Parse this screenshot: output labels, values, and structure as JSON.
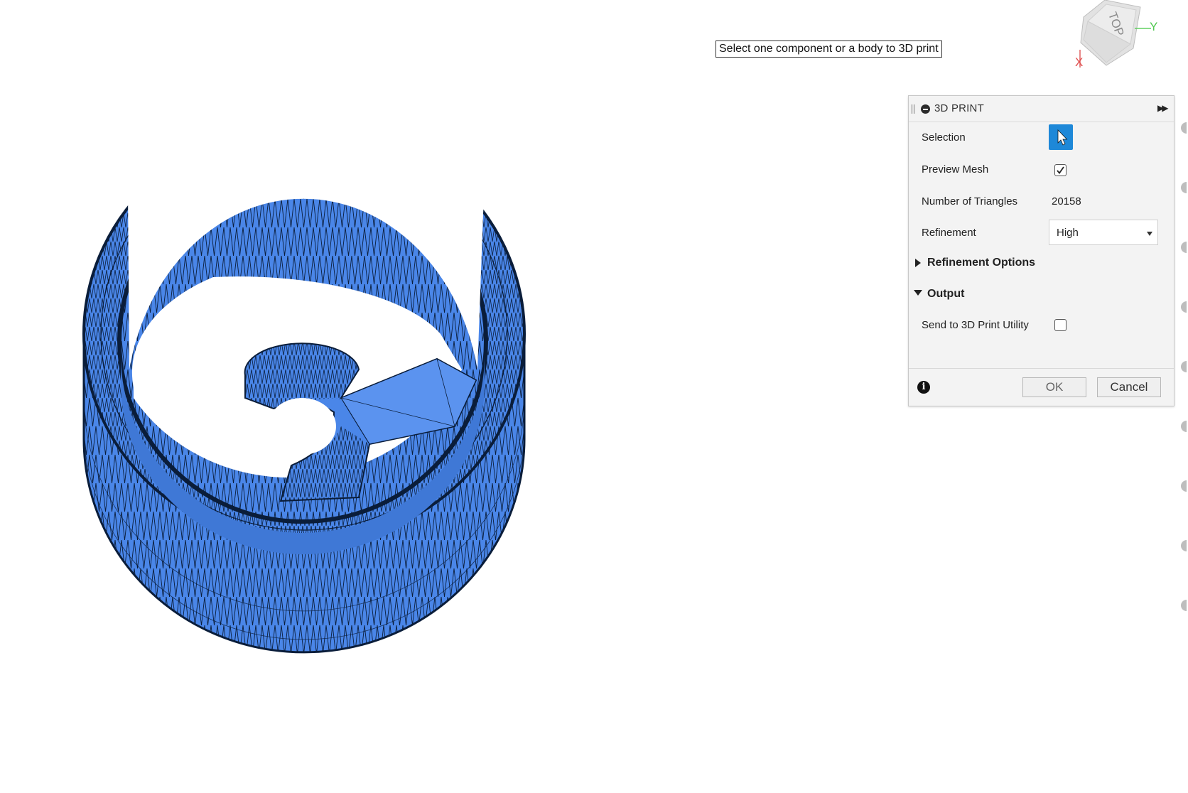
{
  "tooltip": {
    "text": "Select one component or a body to 3D print"
  },
  "viewcube": {
    "face_label": "TOP",
    "axis_x": "X",
    "axis_y": "Y"
  },
  "model": {
    "color": "#4a86e8",
    "edge_color": "#0a1d3a"
  },
  "dialog": {
    "title": "3D PRINT",
    "accent": "#1e88d8",
    "rows": {
      "selection_label": "Selection",
      "preview_mesh_label": "Preview Mesh",
      "preview_mesh_checked": true,
      "triangles_label": "Number of Triangles",
      "triangles_value": "20158",
      "refinement_label": "Refinement",
      "refinement_value": "High"
    },
    "sections": {
      "refinement_options": "Refinement Options",
      "output": "Output"
    },
    "output": {
      "send_label": "Send to 3D Print Utility",
      "send_checked": false
    },
    "buttons": {
      "ok": "OK",
      "cancel": "Cancel"
    }
  }
}
